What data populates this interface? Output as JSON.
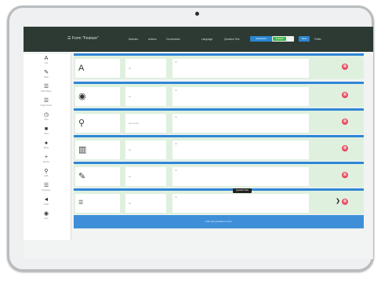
{
  "navbar": {
    "brand": "☰ Form \"Feature\"",
    "items": [
      "Modules",
      "Actions",
      "Connections",
      "Language",
      "Question Text"
    ],
    "questions_label": "Questions",
    "toggle_label": "Enabled",
    "save_label": "Save",
    "last_label": "Public"
  },
  "sidebar": {
    "tools": [
      {
        "icon": "font-icon",
        "glyph": "A",
        "label": "Text"
      },
      {
        "icon": "pencil-icon",
        "glyph": "✎",
        "label": "Draw"
      },
      {
        "icon": "list-icon",
        "glyph": "☰",
        "label": "Multi Choice"
      },
      {
        "icon": "list-icon",
        "glyph": "☰",
        "label": "Single Choice"
      },
      {
        "icon": "clock-icon",
        "glyph": "◷",
        "label": "Time"
      },
      {
        "icon": "video-icon",
        "glyph": "■",
        "label": "Video"
      },
      {
        "icon": "camera-icon",
        "glyph": "●",
        "label": "Photo"
      },
      {
        "icon": "plus-icon",
        "glyph": "+",
        "label": "Number"
      },
      {
        "icon": "location-icon",
        "glyph": "⚲",
        "label": "GPS"
      },
      {
        "icon": "list-icon",
        "glyph": "☰",
        "label": "Dropdown"
      },
      {
        "icon": "send-icon",
        "glyph": "◄",
        "label": "Audio"
      },
      {
        "icon": "eye-icon",
        "glyph": "◉",
        "label": "View"
      }
    ]
  },
  "rows": [
    {
      "icon": "font-icon",
      "glyph": "A",
      "name": "Id",
      "desc": "Id"
    },
    {
      "icon": "camera-icon",
      "glyph": "◉",
      "name": "Id",
      "desc": "Id"
    },
    {
      "icon": "location-icon",
      "glyph": "⚲",
      "name": "Geo point",
      "desc": "Id"
    },
    {
      "icon": "barcode-icon",
      "glyph": "▥",
      "name": "Id",
      "desc": "Id"
    },
    {
      "icon": "pencil-icon",
      "glyph": "✎",
      "name": "Id",
      "desc": "Id"
    },
    {
      "icon": "list-icon",
      "glyph": "☰",
      "name": "Id",
      "desc": "Id"
    }
  ],
  "tooltip": "Question Text",
  "add_label": "Add new question to form"
}
